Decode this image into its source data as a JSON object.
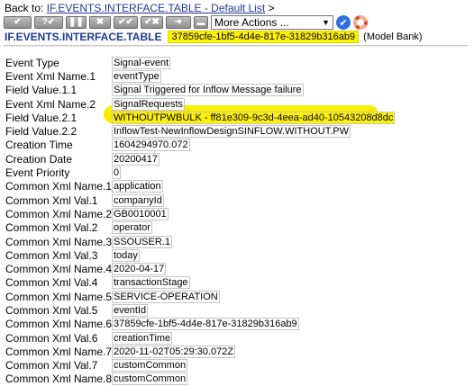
{
  "nav": {
    "back_label": "Back to:",
    "back_link": "IF.EVENTS.INTERFACE.TABLE - Default List",
    "back_suffix": ">"
  },
  "toolbar": {
    "buttons": [
      {
        "icon": "checkmark-icon"
      },
      {
        "icon": "question-icon"
      },
      {
        "icon": "pause-icon"
      },
      {
        "icon": "cross-icon"
      },
      {
        "icon": "double-check-icon"
      },
      {
        "icon": "check-cross-icon"
      },
      {
        "icon": "arrow-right-icon"
      }
    ],
    "more_actions_value": "More Actions ...",
    "ok_icon": "check-circle-icon",
    "help_icon": "lifebuoy-icon"
  },
  "record": {
    "table_name": "IF.EVENTS.INTERFACE.TABLE",
    "id": "37859cfe-1bf5-4d4e-817e-31829b316ab9",
    "company": "(Model Bank)"
  },
  "fields": [
    {
      "label": "Event Type",
      "value": "Signal-event"
    },
    {
      "label": "Event Xml Name.1",
      "value": "eventType"
    },
    {
      "label": "Field Value.1.1",
      "value": "Signal Triggered for Inflow Message failure"
    },
    {
      "label": "Event Xml Name.2",
      "value": "SignalRequests"
    },
    {
      "label": "Field Value.2.1",
      "value": "WITHOUTPWBULK - ff81e309-9c3d-4eea-ad40-10543208d8dc"
    },
    {
      "label": "Field Value.2.2",
      "value": "InflowTest-NewInflowDesignSINFLOW.WITHOUT.PW"
    },
    {
      "label": "Creation Time",
      "value": "1604294970.072"
    },
    {
      "label": "Creation Date",
      "value": "20200417"
    },
    {
      "label": "Event Priority",
      "value": "0"
    },
    {
      "label": "Common Xml Name.1",
      "value": "application"
    },
    {
      "label": "Common Xml Val.1",
      "value": "companyId"
    },
    {
      "label": "Common Xml Name.2",
      "value": "GB0010001"
    },
    {
      "label": "Common Xml Val.2",
      "value": "operator"
    },
    {
      "label": "Common Xml Name.3",
      "value": "SSOUSER.1"
    },
    {
      "label": "Common Xml Val.3",
      "value": "today"
    },
    {
      "label": "Common Xml Name.4",
      "value": "2020-04-17"
    },
    {
      "label": "Common Xml Val.4",
      "value": "transactionStage"
    },
    {
      "label": "Common Xml Name.5",
      "value": "SERVICE-OPERATION"
    },
    {
      "label": "Common Xml Val.5",
      "value": "eventId"
    },
    {
      "label": "Common Xml Name.6",
      "value": "37859cfe-1bf5-4d4e-817e-31829b316ab9"
    },
    {
      "label": "Common Xml Val.6",
      "value": "creationTime"
    },
    {
      "label": "Common Xml Name.7",
      "value": "2020-11-02T05:29:30.072Z"
    },
    {
      "label": "Common Xml Val.7",
      "value": "customCommon"
    },
    {
      "label": "Common Xml Name.8",
      "value": ""
    }
  ],
  "highlight_color": "#fff200",
  "link_color": "#1f3a93"
}
